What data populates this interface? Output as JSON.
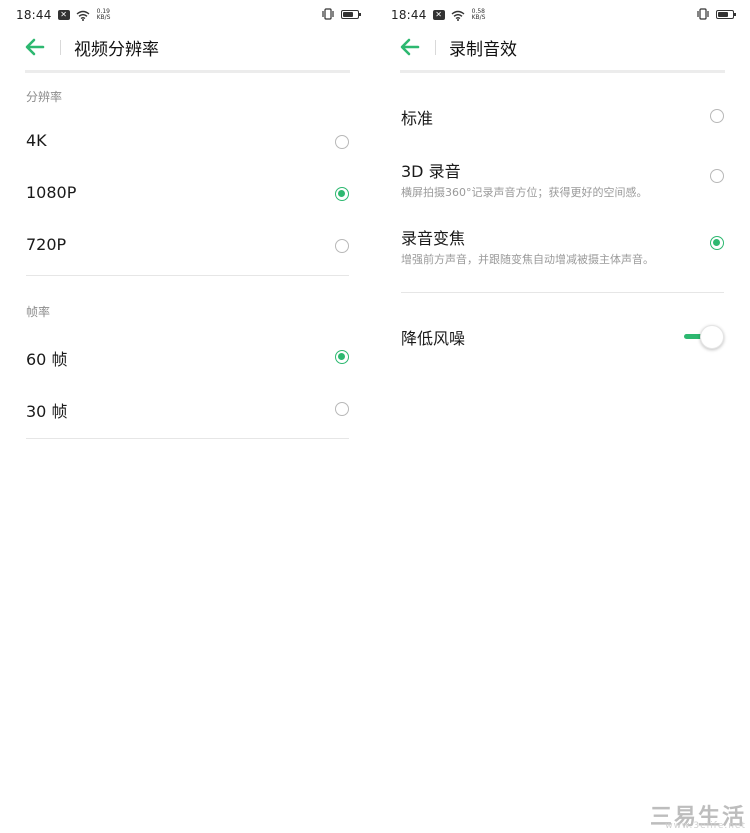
{
  "accent_color": "#2db870",
  "left": {
    "status": {
      "time": "18:44",
      "speed_value": "0.19",
      "speed_unit": "KB/S"
    },
    "header": {
      "title": "视频分辨率"
    },
    "resolution": {
      "label": "分辨率",
      "options": [
        {
          "label": "4K",
          "selected": false
        },
        {
          "label": "1080P",
          "selected": true
        },
        {
          "label": "720P",
          "selected": false
        }
      ]
    },
    "framerate": {
      "label": "帧率",
      "options": [
        {
          "label": "60 帧",
          "selected": true
        },
        {
          "label": "30 帧",
          "selected": false
        }
      ]
    }
  },
  "right": {
    "status": {
      "time": "18:44",
      "speed_value": "0.58",
      "speed_unit": "KB/S"
    },
    "header": {
      "title": "录制音效"
    },
    "options": [
      {
        "label": "标准",
        "subtitle": "",
        "selected": false
      },
      {
        "label": "3D 录音",
        "subtitle": "横屏拍摄360°记录声音方位；获得更好的空间感。",
        "selected": false
      },
      {
        "label": "录音变焦",
        "subtitle": "增强前方声音，并跟随变焦自动增减被摄主体声音。",
        "selected": true
      }
    ],
    "noise_reduction": {
      "label": "降低风噪",
      "enabled": true
    }
  },
  "watermark": {
    "brand": "三易生活",
    "url": "www.3elife.net"
  }
}
